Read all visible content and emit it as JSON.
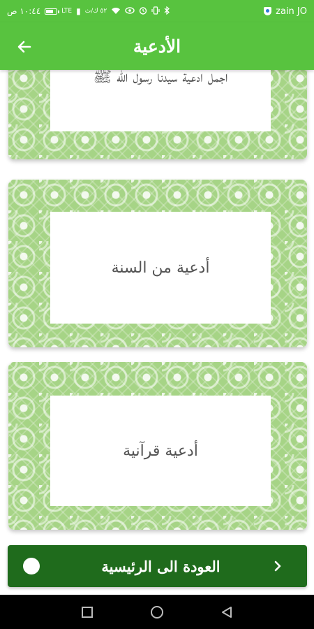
{
  "status_bar": {
    "time": "١٠:٤٤ ص",
    "network": "LTE",
    "speed": "٥٢ ك/ث",
    "carrier": "zain JO"
  },
  "header": {
    "title": "الأدعية",
    "back_icon": "arrow-left-icon"
  },
  "cards": [
    {
      "label": "اجمل ادعية سيدنا رسول الله ﷺ"
    },
    {
      "label": "أدعية من السنة"
    },
    {
      "label": "أدعية قرآنية"
    }
  ],
  "home_button": {
    "label": "العودة الى الرئيسية"
  },
  "colors": {
    "app_bar": "#58c33f",
    "pattern_green": "#a6d486",
    "home_button": "#1f6b1c"
  }
}
